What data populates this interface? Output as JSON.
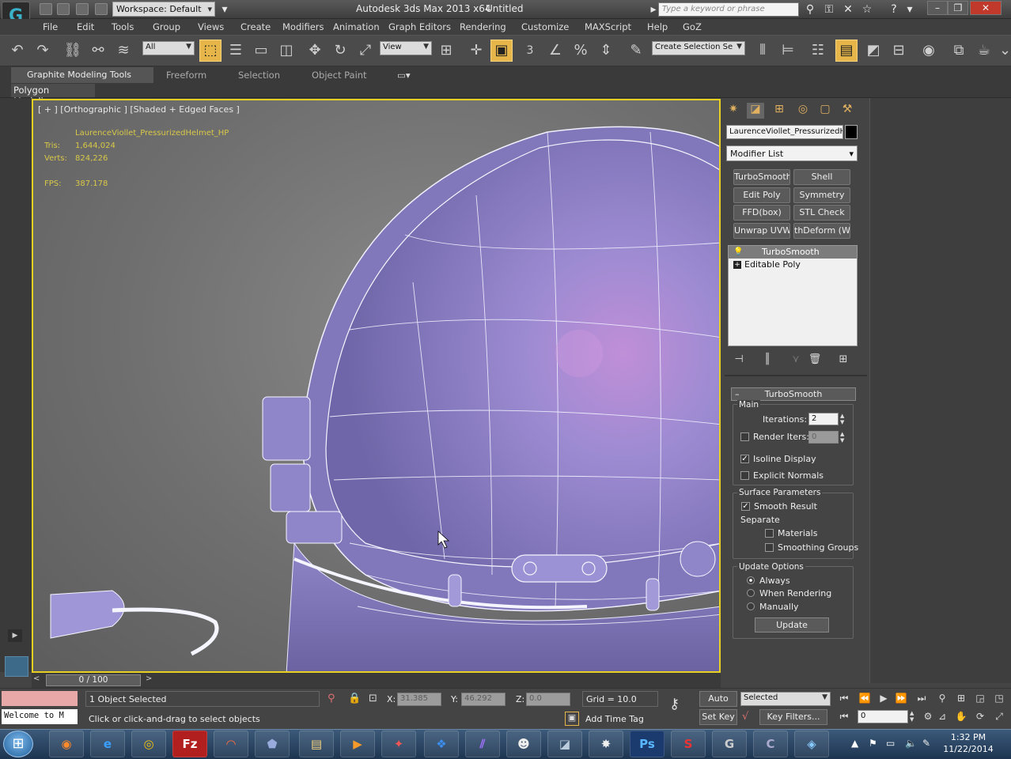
{
  "titlebar": {
    "workspace": "Workspace: Default",
    "app_title": "Autodesk 3ds Max  2013 x64",
    "file_name": "Untitled",
    "search_placeholder": "Type a keyword or phrase",
    "app_logo": "G"
  },
  "menu": [
    "File",
    "Edit",
    "Tools",
    "Group",
    "Views",
    "Create",
    "Modifiers",
    "Animation",
    "Graph Editors",
    "Rendering",
    "Customize",
    "MAXScript",
    "Help",
    "GoZ"
  ],
  "toolbar": {
    "selection_filter": "All",
    "ref_coord": "View",
    "ref_num": "3",
    "named_selection_placeholder": "Create Selection Se"
  },
  "ribbon": {
    "tabs": [
      "Graphite Modeling Tools",
      "Freeform",
      "Selection",
      "Object Paint"
    ],
    "panel": "Polygon Modeling"
  },
  "viewport": {
    "label": "[ + ] [Orthographic ] [Shaded + Edged Faces ]",
    "object_name": "LaurenceViollet_PressurizedHelmet_HP",
    "tris_label": "Tris:",
    "tris_value": "1,644,024",
    "verts_label": "Verts:",
    "verts_value": "824,226",
    "fps_label": "FPS:",
    "fps_value": "387.178"
  },
  "command_panel": {
    "object_name": "LaurenceViollet_PressurizedH",
    "object_color": "#000000",
    "modifier_list": "Modifier List",
    "modifier_buttons": [
      "TurboSmooth",
      "Shell",
      "Edit Poly",
      "Symmetry",
      "FFD(box)",
      "STL Check",
      "Unwrap UVW",
      "thDeform (WSI"
    ],
    "stack": [
      {
        "name": "TurboSmooth",
        "selected": true
      },
      {
        "name": "Editable Poly",
        "selected": false
      }
    ],
    "rollout_title": "TurboSmooth",
    "main": {
      "group": "Main",
      "iterations_label": "Iterations:",
      "iterations": "2",
      "render_iters_label": "Render Iters:",
      "render_iters": "0",
      "isoline": "Isoline Display",
      "explicit": "Explicit Normals"
    },
    "surface": {
      "group": "Surface Parameters",
      "smooth_result": "Smooth Result",
      "separate": "Separate",
      "materials": "Materials",
      "smoothing_groups": "Smoothing Groups"
    },
    "update_options": {
      "group": "Update Options",
      "always": "Always",
      "when_rendering": "When Rendering",
      "manually": "Manually",
      "update_button": "Update"
    }
  },
  "timeline": {
    "frame": "0 / 100"
  },
  "status": {
    "maxscript": "Welcome to M",
    "selected_count": "1 Object Selected",
    "prompt": "Click or click-and-drag to select objects",
    "x_label": "X:",
    "x_value": "31.385",
    "y_label": "Y:",
    "y_value": "46.292",
    "z_label": "Z:",
    "z_value": "0.0",
    "grid": "Grid = 10.0",
    "auto_key": "Auto Key",
    "selected_combo": "Selected",
    "set_key": "Set Key",
    "key_filters": "Key Filters...",
    "add_time_tag": "Add Time Tag",
    "current_frame": "0"
  },
  "taskbar": {
    "time": "1:32 PM",
    "date": "11/22/2014",
    "apps": [
      "firefox-icon",
      "ie-icon",
      "chrome-icon",
      "filezilla-icon",
      "app5-icon",
      "app6-icon",
      "explorer-icon",
      "media-icon",
      "app9-icon",
      "dropbox-icon",
      "app11-icon",
      "app12-icon",
      "3dsmax-icon",
      "app14-icon",
      "photoshop-icon",
      "app16-icon",
      "app17-icon",
      "app18-icon",
      "app19-icon"
    ]
  },
  "colors": {
    "viewport_border": "#e8d020",
    "active_tool": "#e7b64a",
    "helmet": "#8e85c4"
  }
}
